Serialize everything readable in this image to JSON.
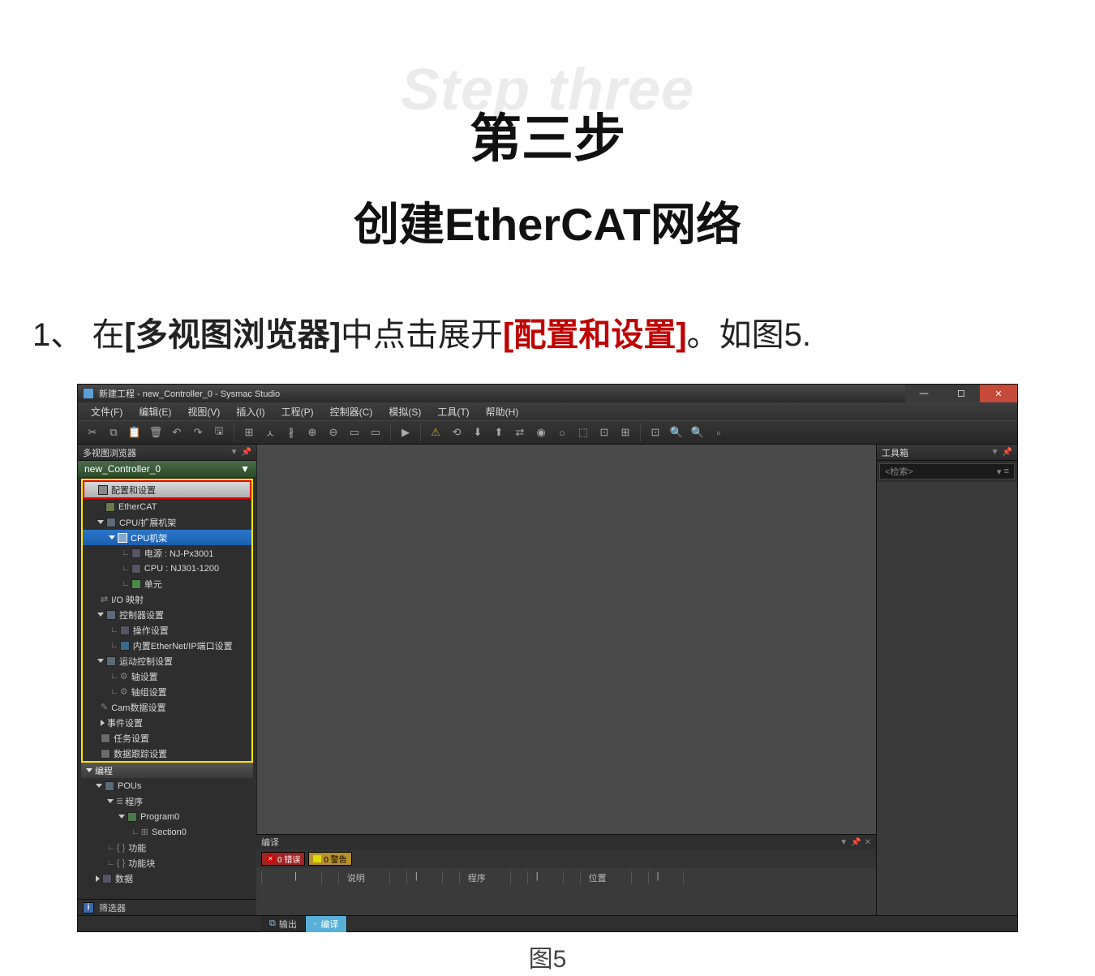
{
  "doc": {
    "bg_step": "Step three",
    "step_cn": "第三步",
    "title": "创建EtherCAT网络",
    "instr_num": "1、",
    "instr_a": "在",
    "instr_b": "[多视图浏览器]",
    "instr_c": "中点击展开",
    "instr_d": "[配置和设置]",
    "instr_e": "。如图5.",
    "fig_caption": "图5"
  },
  "title_bar": "新建工程 - new_Controller_0 - Sysmac Studio",
  "menu": {
    "file": "文件(F)",
    "edit": "编辑(E)",
    "view": "视图(V)",
    "insert": "插入(I)",
    "project": "工程(P)",
    "controller": "控制器(C)",
    "simulate": "模拟(S)",
    "tools": "工具(T)",
    "help": "帮助(H)"
  },
  "left_panel": {
    "title": "多视图浏览器",
    "controller": "new_Controller_0",
    "filter": "筛选器"
  },
  "tree": {
    "config": "配置和设置",
    "ethercat": "EtherCAT",
    "cpu_rack": "CPU/扩展机架",
    "cpu_rack_sub": "CPU机架",
    "power": "电源 : NJ-Px3001",
    "cpu": "CPU : NJ301-1200",
    "unit": "单元",
    "io_map": "I/O 映射",
    "ctrl_set": "控制器设置",
    "op_set": "操作设置",
    "enip": "内置EtherNet/IP端口设置",
    "motion": "运动控制设置",
    "axis": "轴设置",
    "axis_grp": "轴组设置",
    "cam": "Cam数据设置",
    "event": "事件设置",
    "task": "任务设置",
    "trace": "数据跟踪设置",
    "prog_hdr": "编程",
    "pous": "POUs",
    "programs": "程序",
    "program0": "Program0",
    "section0": "Section0",
    "func": "功能",
    "funcblk": "功能块",
    "data": "数据"
  },
  "right_panel": {
    "title": "工具箱",
    "search_ph": "<检索>"
  },
  "compile": {
    "pane_title": "编译",
    "err_label": "0 错误",
    "warn_label": "0 警告",
    "col_desc": "说明",
    "col_prog": "程序",
    "col_loc": "位置"
  },
  "bottom_tabs": {
    "output": "输出",
    "compile": "编译"
  }
}
